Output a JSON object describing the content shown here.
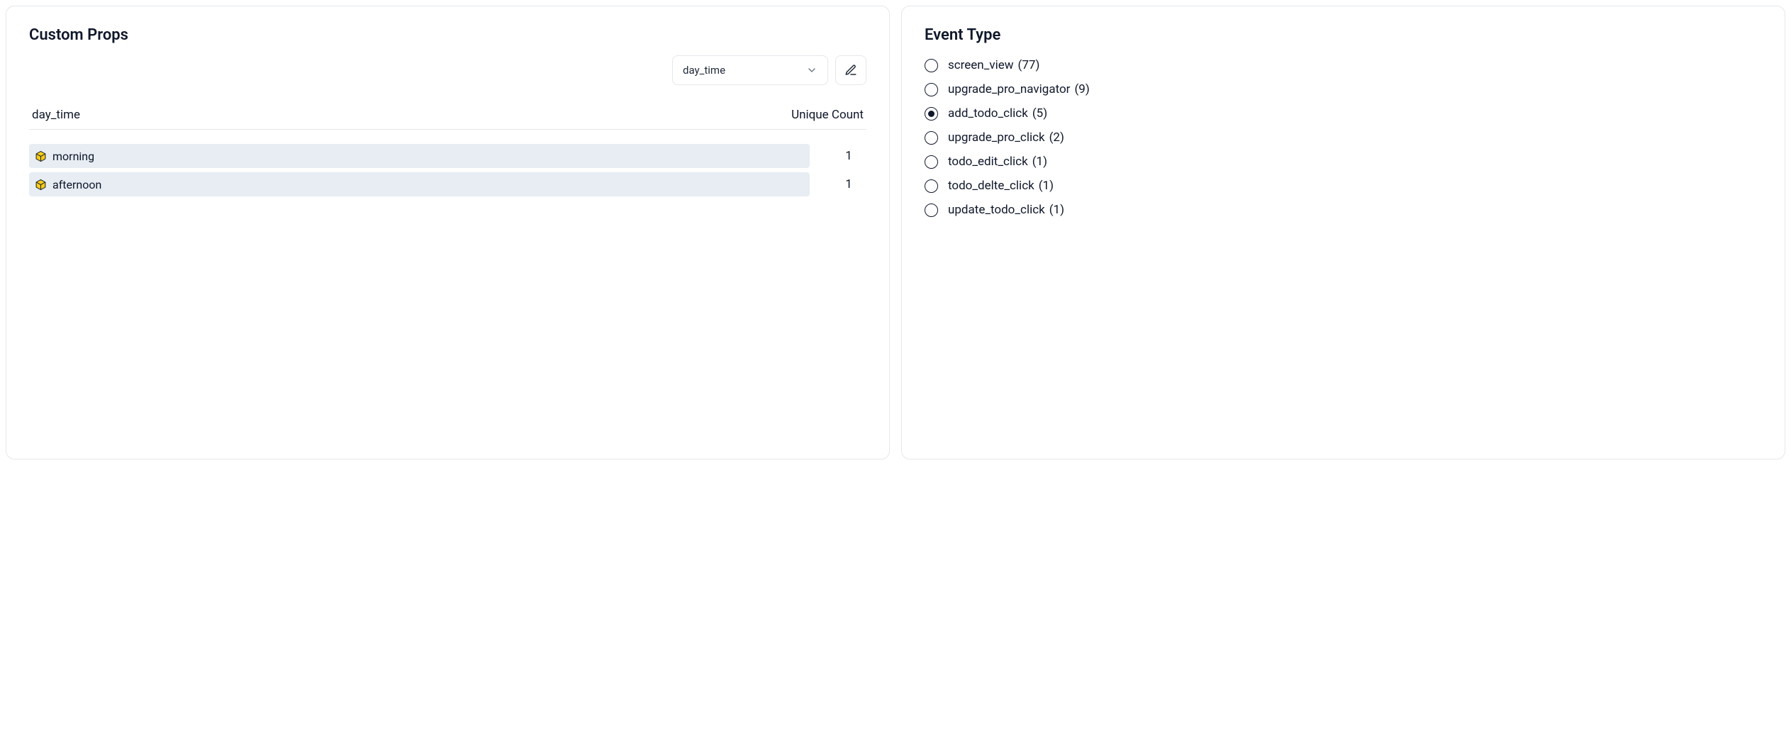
{
  "custom_props": {
    "title": "Custom Props",
    "selected_prop": "day_time",
    "columns": {
      "prop": "day_time",
      "count": "Unique Count"
    },
    "rows": [
      {
        "label": "morning",
        "count": "1"
      },
      {
        "label": "afternoon",
        "count": "1"
      }
    ]
  },
  "event_type": {
    "title": "Event Type",
    "selected_index": 2,
    "items": [
      {
        "name": "screen_view",
        "count": "(77)"
      },
      {
        "name": "upgrade_pro_navigator",
        "count": "(9)"
      },
      {
        "name": "add_todo_click",
        "count": "(5)"
      },
      {
        "name": "upgrade_pro_click",
        "count": "(2)"
      },
      {
        "name": "todo_edit_click",
        "count": "(1)"
      },
      {
        "name": "todo_delte_click",
        "count": "(1)"
      },
      {
        "name": "update_todo_click",
        "count": "(1)"
      }
    ]
  }
}
